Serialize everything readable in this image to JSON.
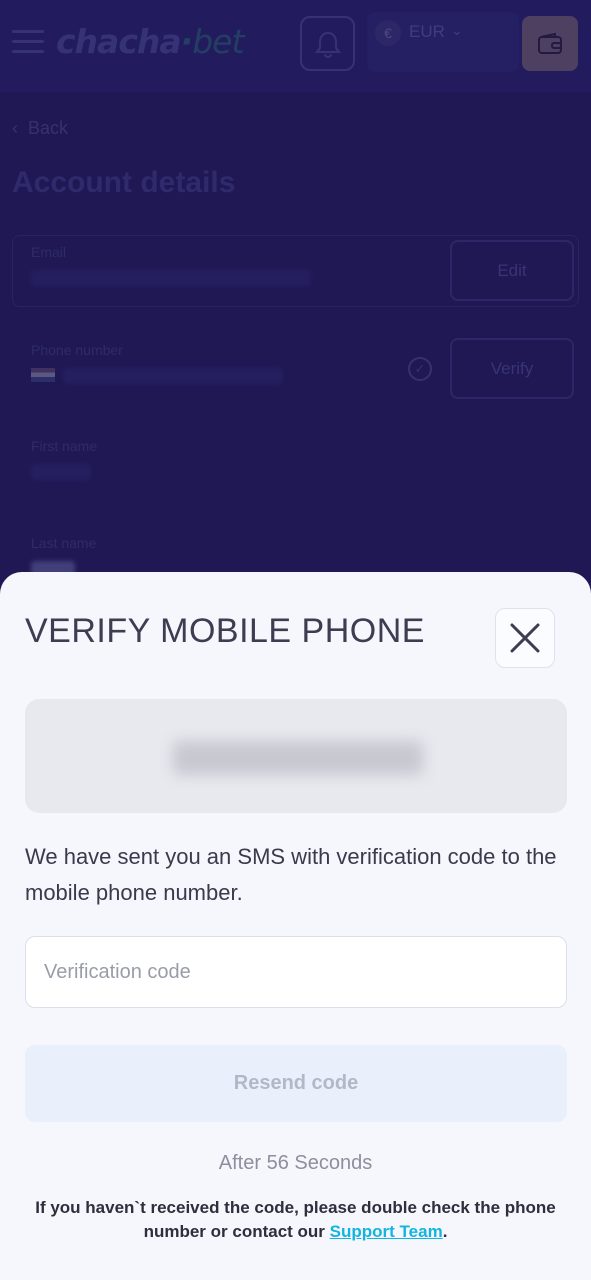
{
  "header": {
    "logo_main": "chacha",
    "logo_dot": "·",
    "logo_suffix": "bet",
    "currency": {
      "symbol": "€",
      "code": "EUR"
    }
  },
  "page": {
    "back_label": "Back",
    "title": "Account details",
    "fields": {
      "email_label": "Email",
      "edit_label": "Edit",
      "phone_label": "Phone number",
      "verify_label": "Verify",
      "first_name_label": "First name",
      "last_name_label": "Last name"
    }
  },
  "modal": {
    "title": "VERIFY MOBILE PHONE",
    "description": "We have sent you an SMS with verification code to the mobile phone number.",
    "code_placeholder": "Verification code",
    "resend_label": "Resend code",
    "timer": "After 56 Seconds",
    "help_prefix": "If you haven`t received the code, please double check the phone number or contact our ",
    "help_link": "Support Team",
    "help_suffix": "."
  }
}
